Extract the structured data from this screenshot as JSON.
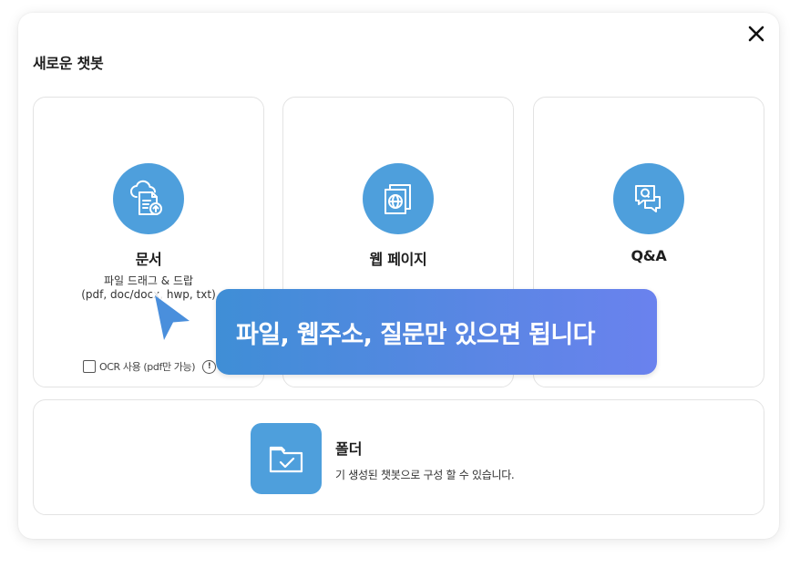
{
  "modal": {
    "title": "새로운 챗봇",
    "close_icon": "close-icon"
  },
  "cards": [
    {
      "label": "문서",
      "icon": "cloud-document-upload-icon",
      "desc_line1": "파일 드래그 & 드랍",
      "desc_line2": "(pdf, doc/docx, hwp, txt)",
      "ocr_label": "OCR 사용 (pdf만 가능)",
      "ocr_checked": false
    },
    {
      "label": "웹 페이지",
      "icon": "web-page-globe-icon"
    },
    {
      "label": "Q&A",
      "icon": "qa-chat-bubbles-icon"
    }
  ],
  "folder": {
    "label": "폴더",
    "desc": "기 생성된 챗봇으로 구성 할 수 있습니다.",
    "icon": "folder-check-icon"
  },
  "tooltip": {
    "text": "파일, 웹주소, 질문만 있으면 됩니다"
  },
  "colors": {
    "accent": "#4e9fdc",
    "tooltip_start": "#3f8ed6",
    "tooltip_end": "#6a82ee"
  }
}
